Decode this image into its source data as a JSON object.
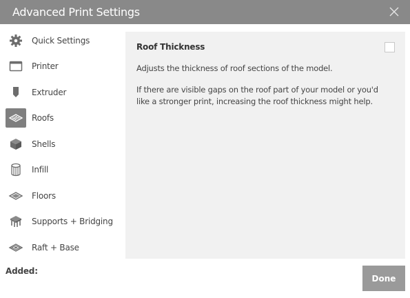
{
  "window": {
    "title": "Advanced Print Settings"
  },
  "sidebar": {
    "items": [
      {
        "label": "Quick Settings",
        "icon": "gear-icon"
      },
      {
        "label": "Printer",
        "icon": "printer-window-icon"
      },
      {
        "label": "Extruder",
        "icon": "extruder-icon"
      },
      {
        "label": "Roofs",
        "icon": "roof-layers-icon",
        "active": true
      },
      {
        "label": "Shells",
        "icon": "cube-icon"
      },
      {
        "label": "Infill",
        "icon": "infill-cylinder-icon"
      },
      {
        "label": "Floors",
        "icon": "floor-layers-icon"
      },
      {
        "label": "Supports + Bridging",
        "icon": "supports-icon"
      },
      {
        "label": "Raft + Base",
        "icon": "raft-layers-icon"
      }
    ]
  },
  "panel": {
    "heading": "Roof Thickness",
    "checked": false,
    "description": "Adjusts the thickness of roof sections of the model.",
    "detail": "If there are visible gaps on the roof part of your model or you'd like a stronger print, increasing the roof thickness might help."
  },
  "footer": {
    "added_label": "Added:",
    "done_label": "Done"
  },
  "colors": {
    "titlebar": "#898989",
    "panel_bg": "#f1f1f1",
    "active_icon_bg": "#7f7f7f",
    "done_button": "#9a9a9a"
  }
}
